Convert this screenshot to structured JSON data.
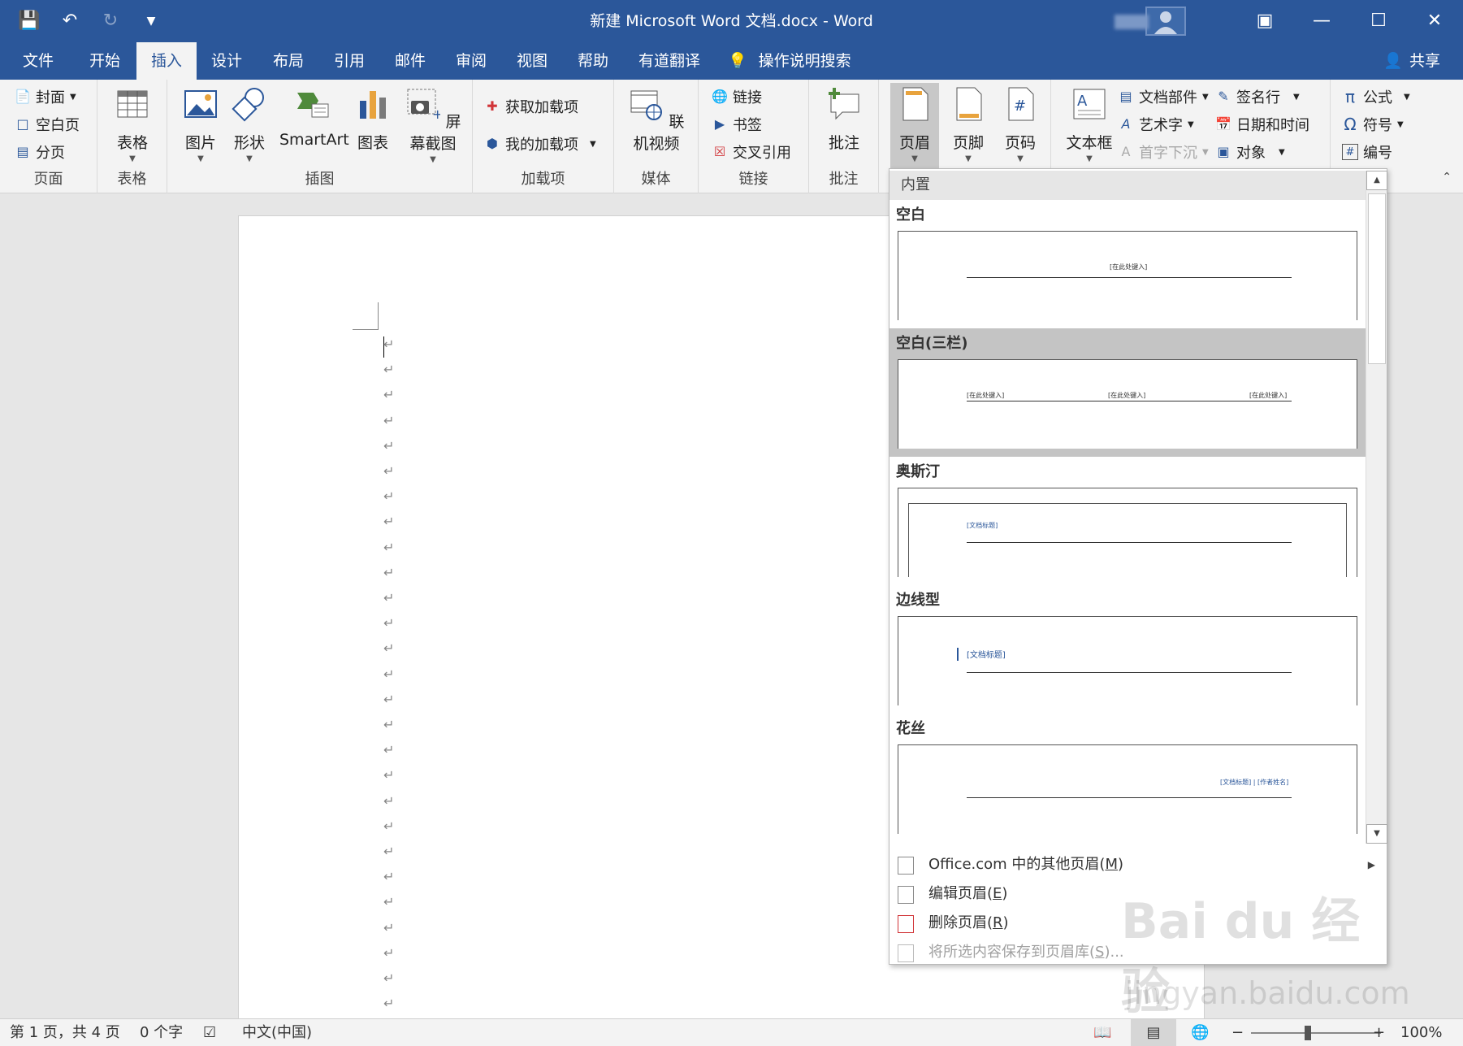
{
  "titlebar": {
    "title": "新建 Microsoft Word 文档.docx  -  Word",
    "save_icon": "save-icon",
    "undo_icon": "undo-icon",
    "redo_icon": "redo-icon",
    "customize_icon": "customize-qat-icon"
  },
  "tabs": [
    {
      "label": "文件"
    },
    {
      "label": "开始"
    },
    {
      "label": "插入",
      "active": true
    },
    {
      "label": "设计"
    },
    {
      "label": "布局"
    },
    {
      "label": "引用"
    },
    {
      "label": "邮件"
    },
    {
      "label": "审阅"
    },
    {
      "label": "视图"
    },
    {
      "label": "帮助"
    },
    {
      "label": "有道翻译"
    }
  ],
  "tell_me": "操作说明搜索",
  "share": "共享",
  "ribbon": {
    "pages": {
      "label": "页面",
      "cover": "封面",
      "blank": "空白页",
      "break": "分页"
    },
    "tables": {
      "label": "表格",
      "table": "表格"
    },
    "illustrations": {
      "label": "插图",
      "pictures": "图片",
      "shapes": "形状",
      "smartart": "SmartArt",
      "chart": "图表",
      "screenshot": "屏幕截图"
    },
    "addins": {
      "label": "加载项",
      "get": "获取加载项",
      "my": "我的加载项"
    },
    "media": {
      "label": "媒体",
      "video": "联机视频"
    },
    "links": {
      "label": "链接",
      "link": "链接",
      "bookmark": "书签",
      "xref": "交叉引用"
    },
    "comments": {
      "label": "批注",
      "comment": "批注"
    },
    "headerfooter": {
      "header": "页眉",
      "footer": "页脚",
      "pagenum": "页码"
    },
    "text": {
      "textbox": "文本框",
      "quickparts": "文档部件",
      "wordart": "艺术字",
      "dropcap": "首字下沉",
      "signature": "签名行",
      "datetime": "日期和时间",
      "object": "对象"
    },
    "symbols": {
      "equation": "公式",
      "symbol": "符号",
      "number": "编号"
    }
  },
  "dropdown": {
    "section": "内置",
    "items": [
      {
        "name": "空白",
        "ph": "[在此处键入]"
      },
      {
        "name": "空白(三栏)",
        "ph": "[在此处键入]"
      },
      {
        "name": "奥斯汀",
        "ph": "[文档标题]"
      },
      {
        "name": "边线型",
        "ph": "[文档标题]"
      },
      {
        "name": "花丝",
        "ph": "[文档标题] | [作者姓名]"
      }
    ],
    "menu": {
      "office_pre": "Office.com 中的其他页眉(",
      "office_key": "M",
      "edit_pre": "编辑页眉(",
      "edit_key": "E",
      "remove_pre": "删除页眉(",
      "remove_key": "R",
      "save_pre": "将所选内容保存到页眉库(",
      "save_key": "S",
      "save_post": ")...",
      "close": ")"
    }
  },
  "status": {
    "page": "第 1 页，共 4 页",
    "words": "0 个字",
    "lang": "中文(中国)",
    "zoom": "100%"
  },
  "watermark": {
    "brand": "Bai du 经验",
    "url": "jingyan.baidu.com"
  }
}
